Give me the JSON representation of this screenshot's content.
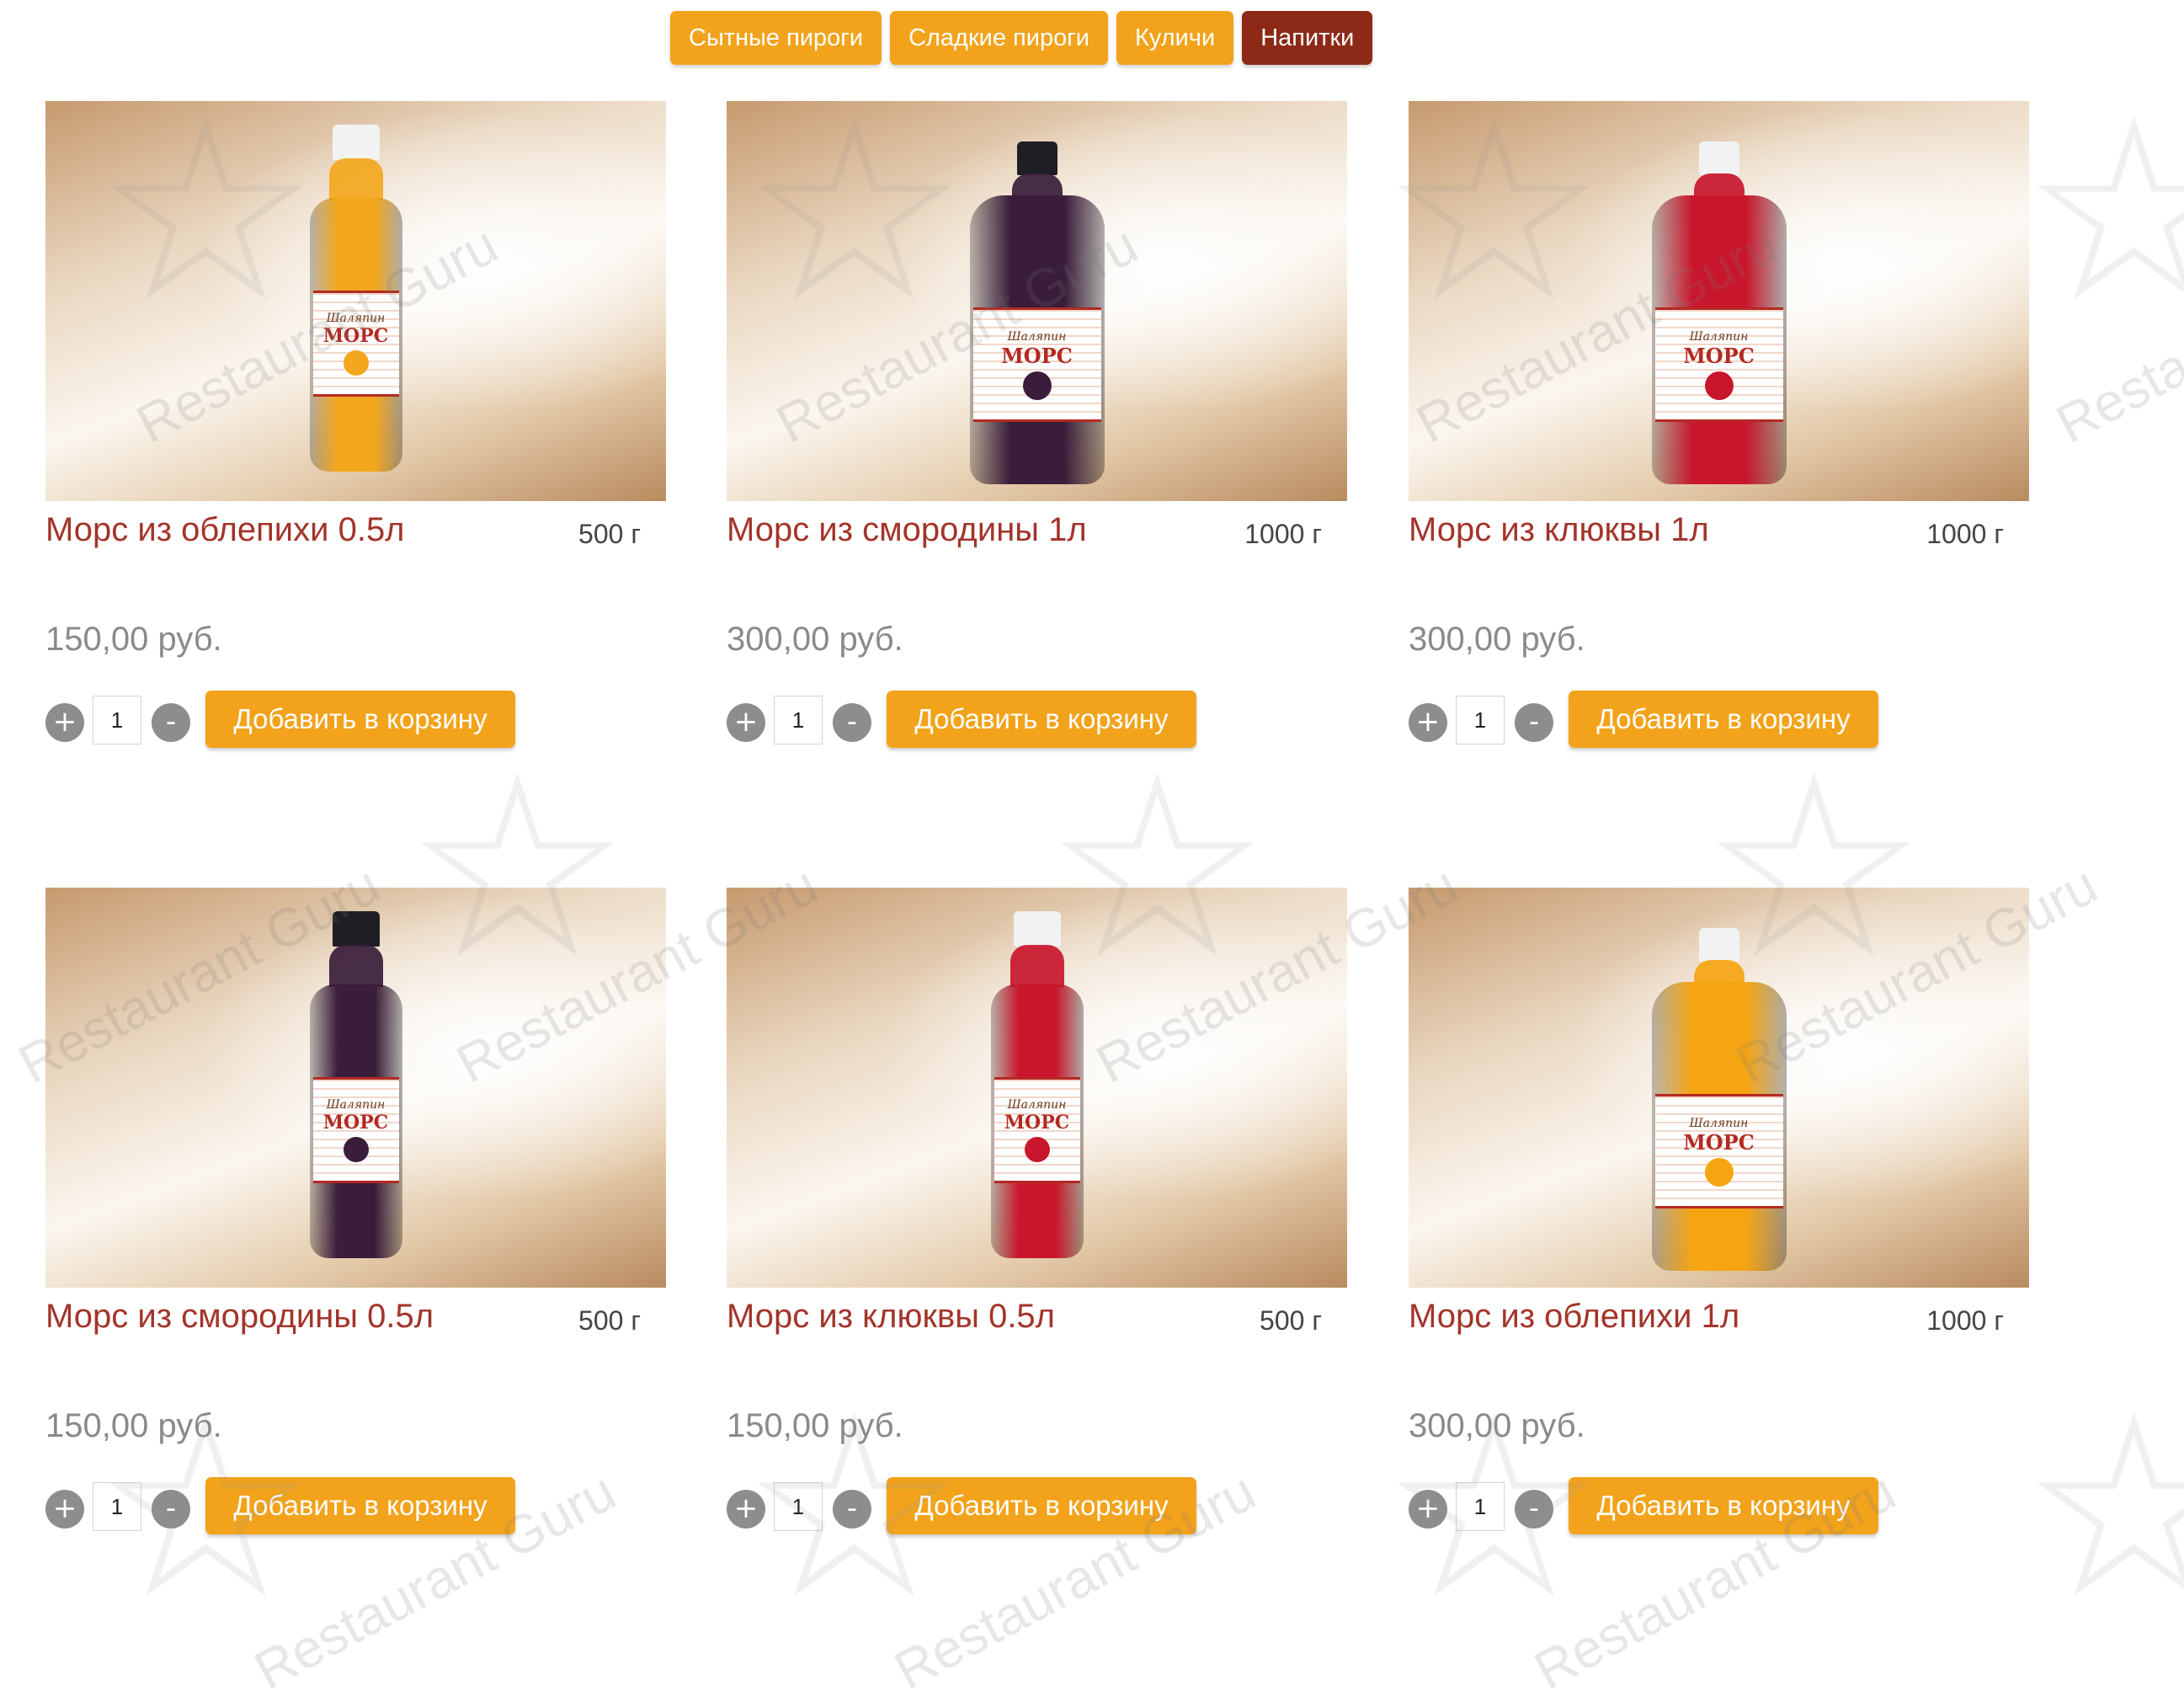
{
  "tabs": [
    {
      "label": "Сытные пироги",
      "active": false
    },
    {
      "label": "Сладкие пироги",
      "active": false
    },
    {
      "label": "Куличи",
      "active": false
    },
    {
      "label": "Напитки",
      "active": true
    }
  ],
  "products": [
    {
      "title": "Морс из облепихи 0.5л",
      "weight": "500 г",
      "price": "150,00 руб.",
      "qty": "1",
      "add_label": "Добавить в корзину",
      "label_word": "МОРС",
      "bottle_color": "#f3a71c",
      "cap_color": "#f2f2f2"
    },
    {
      "title": "Морс из смородины 1л",
      "weight": "1000 г",
      "price": "300,00 руб.",
      "qty": "1",
      "add_label": "Добавить в корзину",
      "label_word": "МОРС",
      "bottle_color": "#3a1d3a",
      "cap_color": "#1e1e24"
    },
    {
      "title": "Морс из клюквы 1л",
      "weight": "1000 г",
      "price": "300,00 руб.",
      "qty": "1",
      "add_label": "Добавить в корзину",
      "label_word": "МОРС",
      "bottle_color": "#c8172c",
      "cap_color": "#f2f2f2"
    },
    {
      "title": "Морс из смородины 0.5л",
      "weight": "500 г",
      "price": "150,00 руб.",
      "qty": "1",
      "add_label": "Добавить в корзину",
      "label_word": "МОРС",
      "bottle_color": "#3a1d3a",
      "cap_color": "#1e1e24"
    },
    {
      "title": "Морс из клюквы 0.5л",
      "weight": "500 г",
      "price": "150,00 руб.",
      "qty": "1",
      "add_label": "Добавить в корзину",
      "label_word": "МОРС",
      "bottle_color": "#c8172c",
      "cap_color": "#f2f2f2"
    },
    {
      "title": "Морс из облепихи 1л",
      "weight": "1000 г",
      "price": "300,00 руб.",
      "qty": "1",
      "add_label": "Добавить в корзину",
      "label_word": "МОРС",
      "bottle_color": "#f5a512",
      "cap_color": "#f2f2f2"
    }
  ],
  "qty_controls": {
    "plus": "+",
    "minus": "-"
  },
  "watermark": {
    "text": "Restaurant Guru"
  }
}
